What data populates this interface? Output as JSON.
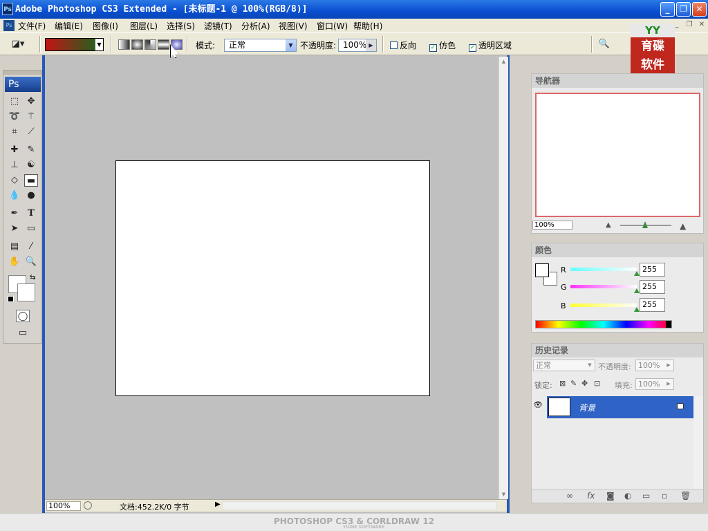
{
  "window": {
    "title": "Adobe Photoshop CS3 Extended - [未标题-1 @ 100%(RGB/8)]",
    "ps_icon": "Ps"
  },
  "menu": [
    "文件(F)",
    "编辑(E)",
    "图像(I)",
    "图层(L)",
    "选择(S)",
    "滤镜(T)",
    "分析(A)",
    "视图(V)",
    "窗口(W)",
    "帮助(H)"
  ],
  "options": {
    "mode_label": "模式:",
    "mode_value": "正常",
    "opacity_label": "不透明度:",
    "opacity_value": "100%",
    "reverse_label": "反向",
    "reverse_checked": false,
    "dither_label": "仿色",
    "dither_checked": true,
    "transparency_label": "透明区域",
    "transparency_checked": true,
    "gradient_start_color": "#c41414",
    "gradient_end_color": "#0f6a1f"
  },
  "logo": {
    "top": "YY",
    "line1": "育碟",
    "line2": "软件"
  },
  "toolbox": {
    "header": "Ps"
  },
  "status": {
    "zoom": "100%",
    "doc": "文档:452.2K/0 字节"
  },
  "navigator": {
    "title": "导航器",
    "zoom": "100%"
  },
  "color": {
    "title": "颜色",
    "r_label": "R",
    "r": "255",
    "g_label": "G",
    "g": "255",
    "b_label": "B",
    "b": "255"
  },
  "history": {
    "title": "历史记录"
  },
  "layers": {
    "blend_mode": "正常",
    "opacity_label": "不透明度:",
    "opacity": "100%",
    "lock_label": "锁定:",
    "fill_label": "填充:",
    "fill": "100%",
    "layer_name": "背景"
  },
  "footer": {
    "text": "PHOTOSHOP CS3 & CORLDRAW 12",
    "sub": "YUDIE SOFTWARE"
  }
}
